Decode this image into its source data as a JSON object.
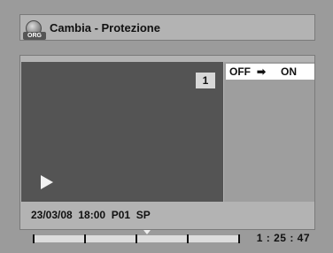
{
  "header": {
    "icon_label": "ORG",
    "title": "Cambia - Protezione"
  },
  "video": {
    "title_number": "1"
  },
  "options": {
    "off_label": "OFF",
    "arrow": "➡",
    "on_label": "ON"
  },
  "info": {
    "text": "23/03/08  18:00  P01  SP"
  },
  "playback": {
    "time": "1 : 25 : 47",
    "progress_fraction": 0.55
  },
  "colors": {
    "background": "#9b9b9b",
    "panel": "#b3b3b3",
    "video": "#545454",
    "highlight": "#ffffff"
  }
}
